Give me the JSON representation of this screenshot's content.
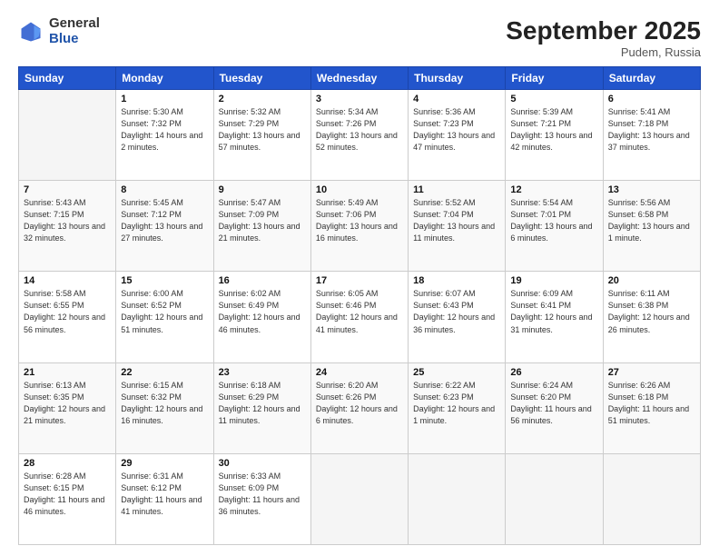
{
  "header": {
    "logo_general": "General",
    "logo_blue": "Blue",
    "month_title": "September 2025",
    "location": "Pudem, Russia"
  },
  "days_of_week": [
    "Sunday",
    "Monday",
    "Tuesday",
    "Wednesday",
    "Thursday",
    "Friday",
    "Saturday"
  ],
  "weeks": [
    [
      {
        "day": null
      },
      {
        "day": 1,
        "sunrise": "5:30 AM",
        "sunset": "7:32 PM",
        "daylight": "14 hours and 2 minutes."
      },
      {
        "day": 2,
        "sunrise": "5:32 AM",
        "sunset": "7:29 PM",
        "daylight": "13 hours and 57 minutes."
      },
      {
        "day": 3,
        "sunrise": "5:34 AM",
        "sunset": "7:26 PM",
        "daylight": "13 hours and 52 minutes."
      },
      {
        "day": 4,
        "sunrise": "5:36 AM",
        "sunset": "7:23 PM",
        "daylight": "13 hours and 47 minutes."
      },
      {
        "day": 5,
        "sunrise": "5:39 AM",
        "sunset": "7:21 PM",
        "daylight": "13 hours and 42 minutes."
      },
      {
        "day": 6,
        "sunrise": "5:41 AM",
        "sunset": "7:18 PM",
        "daylight": "13 hours and 37 minutes."
      }
    ],
    [
      {
        "day": 7,
        "sunrise": "5:43 AM",
        "sunset": "7:15 PM",
        "daylight": "13 hours and 32 minutes."
      },
      {
        "day": 8,
        "sunrise": "5:45 AM",
        "sunset": "7:12 PM",
        "daylight": "13 hours and 27 minutes."
      },
      {
        "day": 9,
        "sunrise": "5:47 AM",
        "sunset": "7:09 PM",
        "daylight": "13 hours and 21 minutes."
      },
      {
        "day": 10,
        "sunrise": "5:49 AM",
        "sunset": "7:06 PM",
        "daylight": "13 hours and 16 minutes."
      },
      {
        "day": 11,
        "sunrise": "5:52 AM",
        "sunset": "7:04 PM",
        "daylight": "13 hours and 11 minutes."
      },
      {
        "day": 12,
        "sunrise": "5:54 AM",
        "sunset": "7:01 PM",
        "daylight": "13 hours and 6 minutes."
      },
      {
        "day": 13,
        "sunrise": "5:56 AM",
        "sunset": "6:58 PM",
        "daylight": "13 hours and 1 minute."
      }
    ],
    [
      {
        "day": 14,
        "sunrise": "5:58 AM",
        "sunset": "6:55 PM",
        "daylight": "12 hours and 56 minutes."
      },
      {
        "day": 15,
        "sunrise": "6:00 AM",
        "sunset": "6:52 PM",
        "daylight": "12 hours and 51 minutes."
      },
      {
        "day": 16,
        "sunrise": "6:02 AM",
        "sunset": "6:49 PM",
        "daylight": "12 hours and 46 minutes."
      },
      {
        "day": 17,
        "sunrise": "6:05 AM",
        "sunset": "6:46 PM",
        "daylight": "12 hours and 41 minutes."
      },
      {
        "day": 18,
        "sunrise": "6:07 AM",
        "sunset": "6:43 PM",
        "daylight": "12 hours and 36 minutes."
      },
      {
        "day": 19,
        "sunrise": "6:09 AM",
        "sunset": "6:41 PM",
        "daylight": "12 hours and 31 minutes."
      },
      {
        "day": 20,
        "sunrise": "6:11 AM",
        "sunset": "6:38 PM",
        "daylight": "12 hours and 26 minutes."
      }
    ],
    [
      {
        "day": 21,
        "sunrise": "6:13 AM",
        "sunset": "6:35 PM",
        "daylight": "12 hours and 21 minutes."
      },
      {
        "day": 22,
        "sunrise": "6:15 AM",
        "sunset": "6:32 PM",
        "daylight": "12 hours and 16 minutes."
      },
      {
        "day": 23,
        "sunrise": "6:18 AM",
        "sunset": "6:29 PM",
        "daylight": "12 hours and 11 minutes."
      },
      {
        "day": 24,
        "sunrise": "6:20 AM",
        "sunset": "6:26 PM",
        "daylight": "12 hours and 6 minutes."
      },
      {
        "day": 25,
        "sunrise": "6:22 AM",
        "sunset": "6:23 PM",
        "daylight": "12 hours and 1 minute."
      },
      {
        "day": 26,
        "sunrise": "6:24 AM",
        "sunset": "6:20 PM",
        "daylight": "11 hours and 56 minutes."
      },
      {
        "day": 27,
        "sunrise": "6:26 AM",
        "sunset": "6:18 PM",
        "daylight": "11 hours and 51 minutes."
      }
    ],
    [
      {
        "day": 28,
        "sunrise": "6:28 AM",
        "sunset": "6:15 PM",
        "daylight": "11 hours and 46 minutes."
      },
      {
        "day": 29,
        "sunrise": "6:31 AM",
        "sunset": "6:12 PM",
        "daylight": "11 hours and 41 minutes."
      },
      {
        "day": 30,
        "sunrise": "6:33 AM",
        "sunset": "6:09 PM",
        "daylight": "11 hours and 36 minutes."
      },
      {
        "day": null
      },
      {
        "day": null
      },
      {
        "day": null
      },
      {
        "day": null
      }
    ]
  ]
}
